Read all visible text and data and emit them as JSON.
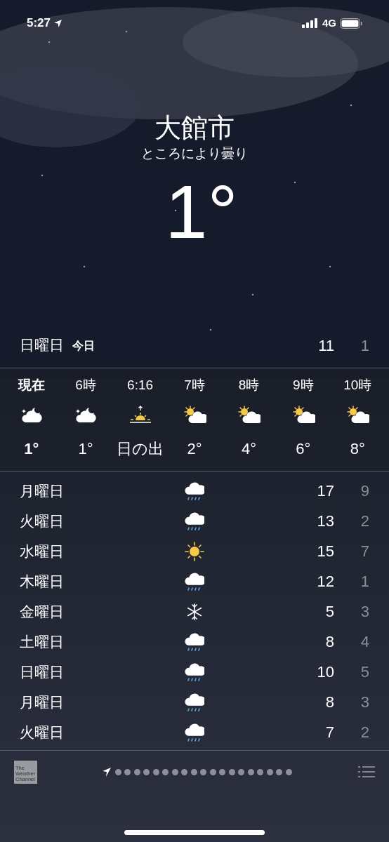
{
  "status_bar": {
    "time": "5:27",
    "network": "4G"
  },
  "location": {
    "city": "大館市",
    "condition": "ところにより曇り",
    "temperature": "1°"
  },
  "today": {
    "day": "日曜日",
    "label": "今日",
    "high": "11",
    "low": "1"
  },
  "hourly": [
    {
      "time": "現在",
      "kind": "cloud-moon",
      "temp": "1°",
      "current": true
    },
    {
      "time": "6時",
      "kind": "cloud-moon",
      "temp": "1°",
      "current": false
    },
    {
      "time": "6:16",
      "kind": "sunrise",
      "temp": "日の出",
      "current": false
    },
    {
      "time": "7時",
      "kind": "cloud-sun",
      "temp": "2°",
      "current": false
    },
    {
      "time": "8時",
      "kind": "cloud-sun",
      "temp": "4°",
      "current": false
    },
    {
      "time": "9時",
      "kind": "cloud-sun",
      "temp": "6°",
      "current": false
    },
    {
      "time": "10時",
      "kind": "cloud-sun",
      "temp": "8°",
      "current": false
    }
  ],
  "daily": [
    {
      "day": "月曜日",
      "kind": "rain",
      "high": "17",
      "low": "9"
    },
    {
      "day": "火曜日",
      "kind": "rain",
      "high": "13",
      "low": "2"
    },
    {
      "day": "水曜日",
      "kind": "sun",
      "high": "15",
      "low": "7"
    },
    {
      "day": "木曜日",
      "kind": "rain",
      "high": "12",
      "low": "1"
    },
    {
      "day": "金曜日",
      "kind": "snow",
      "high": "5",
      "low": "3"
    },
    {
      "day": "土曜日",
      "kind": "rain",
      "high": "8",
      "low": "4"
    },
    {
      "day": "日曜日",
      "kind": "rain",
      "high": "10",
      "low": "5"
    },
    {
      "day": "月曜日",
      "kind": "rain",
      "high": "8",
      "low": "3"
    },
    {
      "day": "火曜日",
      "kind": "rain",
      "high": "7",
      "low": "2"
    }
  ],
  "footer": {
    "logo": "The Weather Channel",
    "location_selected": true,
    "pages": [
      {
        "selected": false
      },
      {
        "selected": false
      },
      {
        "selected": false
      },
      {
        "selected": false
      },
      {
        "selected": false
      },
      {
        "selected": false
      },
      {
        "selected": false
      },
      {
        "selected": false
      },
      {
        "selected": false
      },
      {
        "selected": false
      },
      {
        "selected": false
      },
      {
        "selected": false
      },
      {
        "selected": false
      },
      {
        "selected": false
      },
      {
        "selected": false
      },
      {
        "selected": false
      },
      {
        "selected": false
      },
      {
        "selected": false
      },
      {
        "selected": false
      }
    ]
  }
}
